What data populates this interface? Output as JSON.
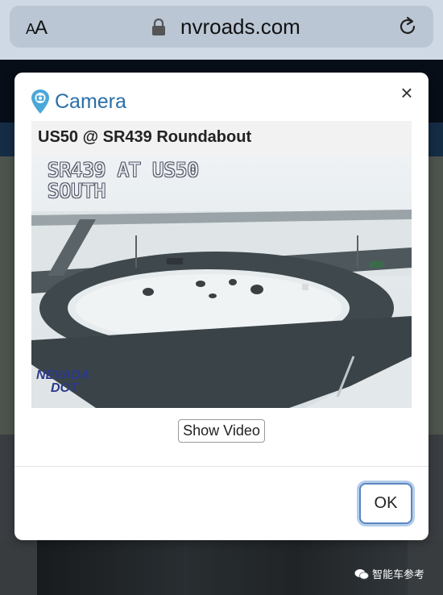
{
  "browser": {
    "text_size_label": "AA",
    "url": "nvroads.com"
  },
  "modal": {
    "title": "Camera",
    "camera_name": "US50 @ SR439 Roundabout",
    "image_overlay_text": "SR439 AT US50\nSOUTH",
    "logo_text_top": "NEVADA",
    "logo_text_bottom": "DOT",
    "show_video_label": "Show Video",
    "ok_label": "OK",
    "close_symbol": "×"
  },
  "watermark": {
    "text": "智能车参考"
  },
  "icons": {
    "lock": "lock-icon",
    "reload": "reload-icon",
    "camera_pin": "camera-pin-icon",
    "close": "close-icon",
    "wechat": "wechat-icon"
  },
  "colors": {
    "title_blue": "#2a6fa8",
    "ok_border": "#5a87c2"
  }
}
